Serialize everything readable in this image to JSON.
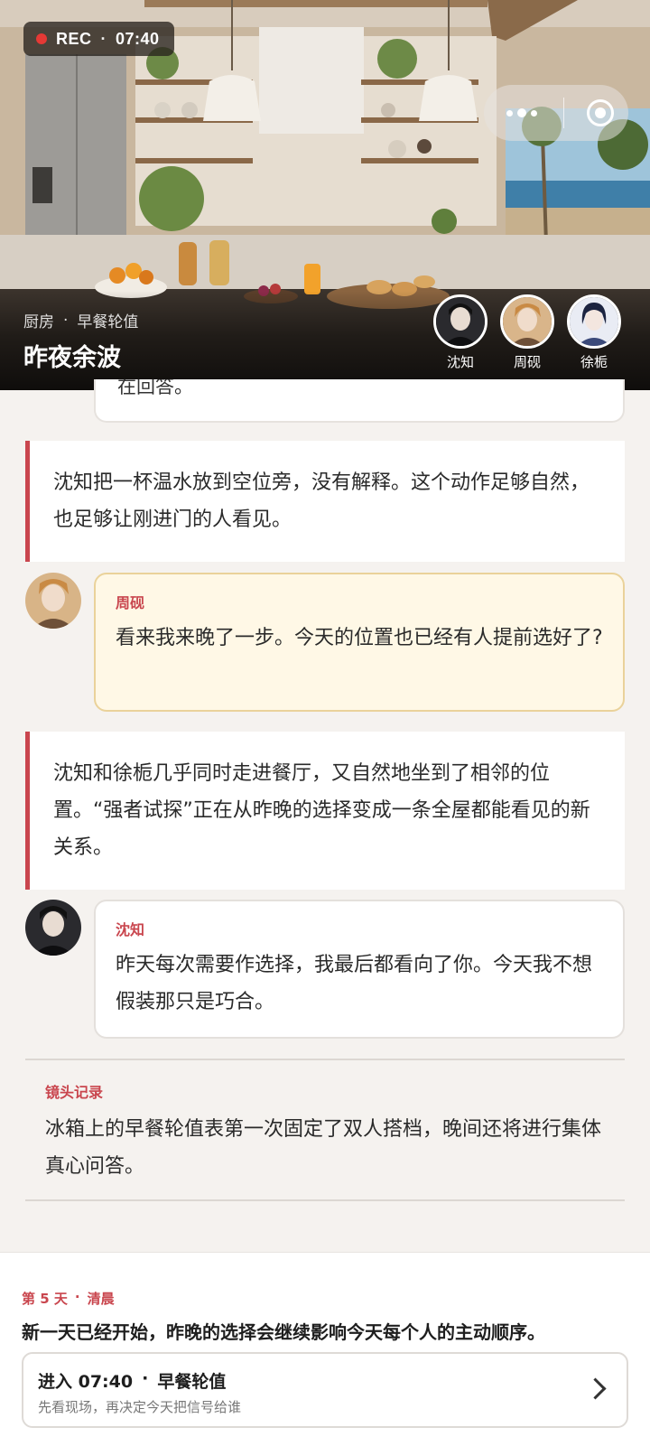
{
  "hero": {
    "rec": {
      "label": "REC",
      "sep": "·",
      "time": "07:40",
      "dot_color": "#e53935"
    },
    "capsule": {
      "more_icon": "more-dots-icon",
      "record_icon": "target-icon"
    },
    "location": "厨房",
    "sep": "·",
    "activity": "早餐轮值",
    "title": "昨夜余波",
    "cast": [
      {
        "name": "沈知"
      },
      {
        "name": "周砚"
      },
      {
        "name": "徐栀"
      }
    ]
  },
  "feed": {
    "prev_tail": "在回答。",
    "narration1": "沈知把一杯温水放到空位旁，没有解释。这个动作足够自然，也足够让刚进门的人看见。",
    "msg1": {
      "speaker": "周砚",
      "text": "看来我来晚了一步。今天的位置也已经有人提前选好了?"
    },
    "narration2": "沈知和徐栀几乎同时走进餐厅，又自然地坐到了相邻的位置。“强者试探”正在从昨晚的选择变成一条全屋都能看见的新关系。",
    "msg2": {
      "speaker": "沈知",
      "text": "昨天每次需要作选择，我最后都看向了你。今天我不想假装那只是巧合。"
    },
    "note": {
      "label": "镜头记录",
      "text": "冰箱上的早餐轮值表第一次固定了双人搭档，晚间还将进行集体真心问答。"
    }
  },
  "sheet": {
    "day": "第 5 天",
    "sep": "·",
    "period": "清晨",
    "headline": "新一天已经开始，昨晚的选择会继续影响今天每个人的主动顺序。",
    "enter": {
      "prefix": "进入 07:40",
      "sep": "·",
      "target": "早餐轮值",
      "sub": "先看现场，再决定今天把信号给谁",
      "icon": "chevron-right-icon"
    }
  },
  "colors": {
    "accent": "#c9464e",
    "warm_bubble": "#fff8e6",
    "page_bg": "#f5f2ef"
  }
}
